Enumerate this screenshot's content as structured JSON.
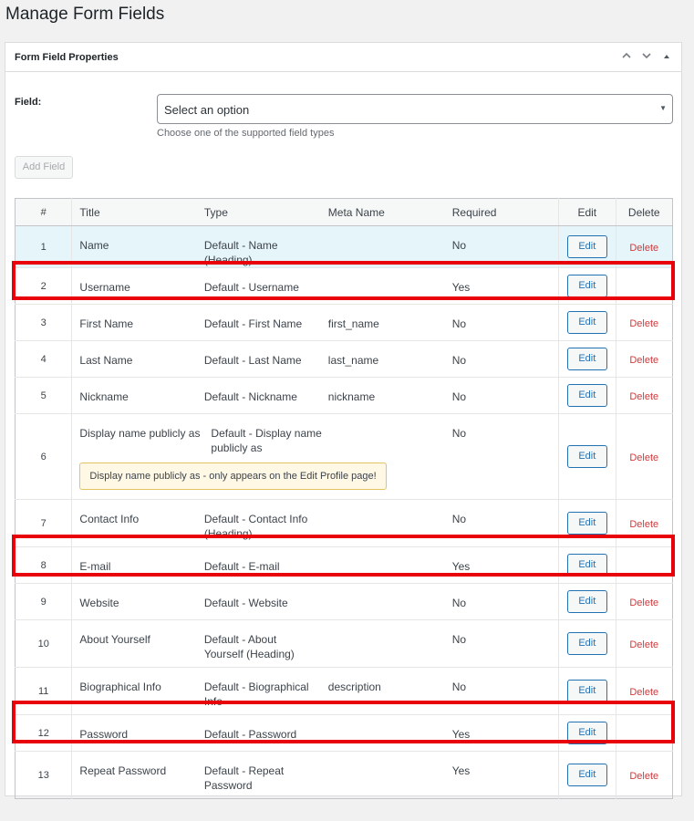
{
  "page": {
    "title": "Manage Form Fields"
  },
  "postbox": {
    "title": "Form Field Properties",
    "handle_icons": [
      "chevron-up-icon",
      "chevron-down-icon",
      "triangle-up-icon"
    ]
  },
  "form": {
    "field_label": "Field:",
    "select_value": "Select an option",
    "select_help": "Choose one of the supported field types",
    "add_button": "Add Field"
  },
  "table": {
    "headers": {
      "num": "#",
      "title": "Title",
      "type": "Type",
      "meta": "Meta Name",
      "required": "Required",
      "edit": "Edit",
      "delete": "Delete"
    },
    "rows": [
      {
        "num": "1",
        "title": "Name",
        "type": "Default - Name (Heading)",
        "meta": "",
        "required": "No",
        "edit": "Edit",
        "delete": "Delete",
        "notice": ""
      },
      {
        "num": "2",
        "title": "Username",
        "type": "Default - Username",
        "meta": "",
        "required": "Yes",
        "edit": "Edit",
        "delete": "",
        "notice": ""
      },
      {
        "num": "3",
        "title": "First Name",
        "type": "Default - First Name",
        "meta": "first_name",
        "required": "No",
        "edit": "Edit",
        "delete": "Delete",
        "notice": ""
      },
      {
        "num": "4",
        "title": "Last Name",
        "type": "Default - Last Name",
        "meta": "last_name",
        "required": "No",
        "edit": "Edit",
        "delete": "Delete",
        "notice": ""
      },
      {
        "num": "5",
        "title": "Nickname",
        "type": "Default - Nickname",
        "meta": "nickname",
        "required": "No",
        "edit": "Edit",
        "delete": "Delete",
        "notice": ""
      },
      {
        "num": "6",
        "title": "Display name publicly as",
        "type": "Default - Display name publicly as",
        "meta": "",
        "required": "No",
        "edit": "Edit",
        "delete": "Delete",
        "notice": "Display name publicly as - only appears on the Edit Profile page!"
      },
      {
        "num": "7",
        "title": "Contact Info",
        "type": "Default - Contact Info (Heading)",
        "meta": "",
        "required": "No",
        "edit": "Edit",
        "delete": "Delete",
        "notice": ""
      },
      {
        "num": "8",
        "title": "E-mail",
        "type": "Default - E-mail",
        "meta": "",
        "required": "Yes",
        "edit": "Edit",
        "delete": "",
        "notice": ""
      },
      {
        "num": "9",
        "title": "Website",
        "type": "Default - Website",
        "meta": "",
        "required": "No",
        "edit": "Edit",
        "delete": "Delete",
        "notice": ""
      },
      {
        "num": "10",
        "title": "About Yourself",
        "type": "Default - About Yourself (Heading)",
        "meta": "",
        "required": "No",
        "edit": "Edit",
        "delete": "Delete",
        "notice": ""
      },
      {
        "num": "11",
        "title": "Biographical Info",
        "type": "Default - Biographical Info",
        "meta": "description",
        "required": "No",
        "edit": "Edit",
        "delete": "Delete",
        "notice": ""
      },
      {
        "num": "12",
        "title": "Password",
        "type": "Default - Password",
        "meta": "",
        "required": "Yes",
        "edit": "Edit",
        "delete": "",
        "notice": ""
      },
      {
        "num": "13",
        "title": "Repeat Password",
        "type": "Default - Repeat Password",
        "meta": "",
        "required": "Yes",
        "edit": "Edit",
        "delete": "Delete",
        "notice": ""
      }
    ]
  },
  "colors": {
    "accent": "#2271b1",
    "delete": "#d63638",
    "highlight_row": "#e5f5fa",
    "annotation_box": "#e8000b",
    "notice_border": "#e4c363"
  }
}
